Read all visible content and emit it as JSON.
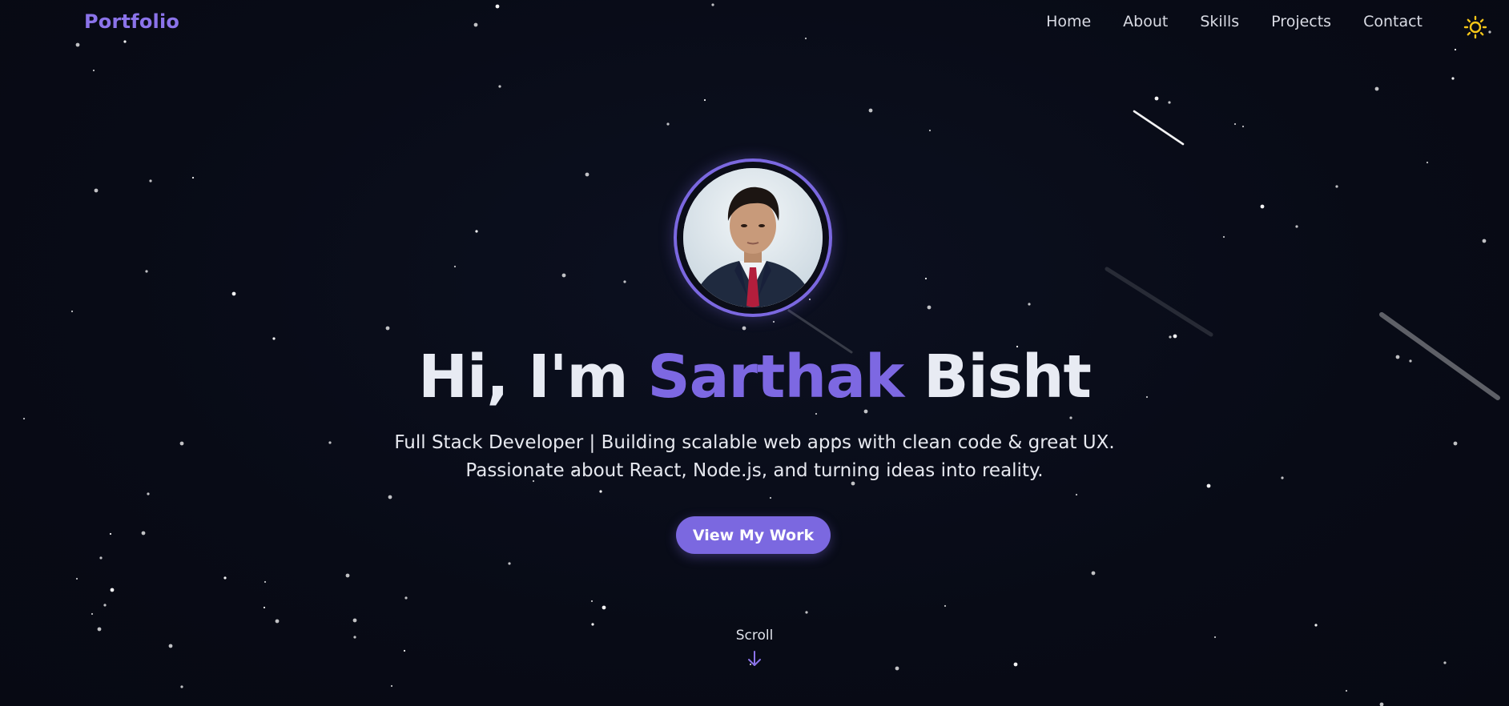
{
  "nav": {
    "brand": "Portfolio",
    "links": [
      "Home",
      "About",
      "Skills",
      "Projects",
      "Contact"
    ]
  },
  "theme_toggle": {
    "icon": "sun-icon"
  },
  "hero": {
    "greeting": "Hi, I'm",
    "first_name": "Sarthak",
    "last_name": "Bisht",
    "subtitle": "Full Stack Developer | Building scalable web apps with clean code & great UX. Passionate about React, Node.js, and turning ideas into reality.",
    "cta_label": "View My Work",
    "avatar": "profile-photo"
  },
  "scroll": {
    "label": "Scroll",
    "icon": "arrow-down-icon"
  },
  "colors": {
    "background": "#080b16",
    "accent": "#7b68e0",
    "text": "#e9ecf5",
    "sun": "#f5c518",
    "star": "#ffffff"
  }
}
